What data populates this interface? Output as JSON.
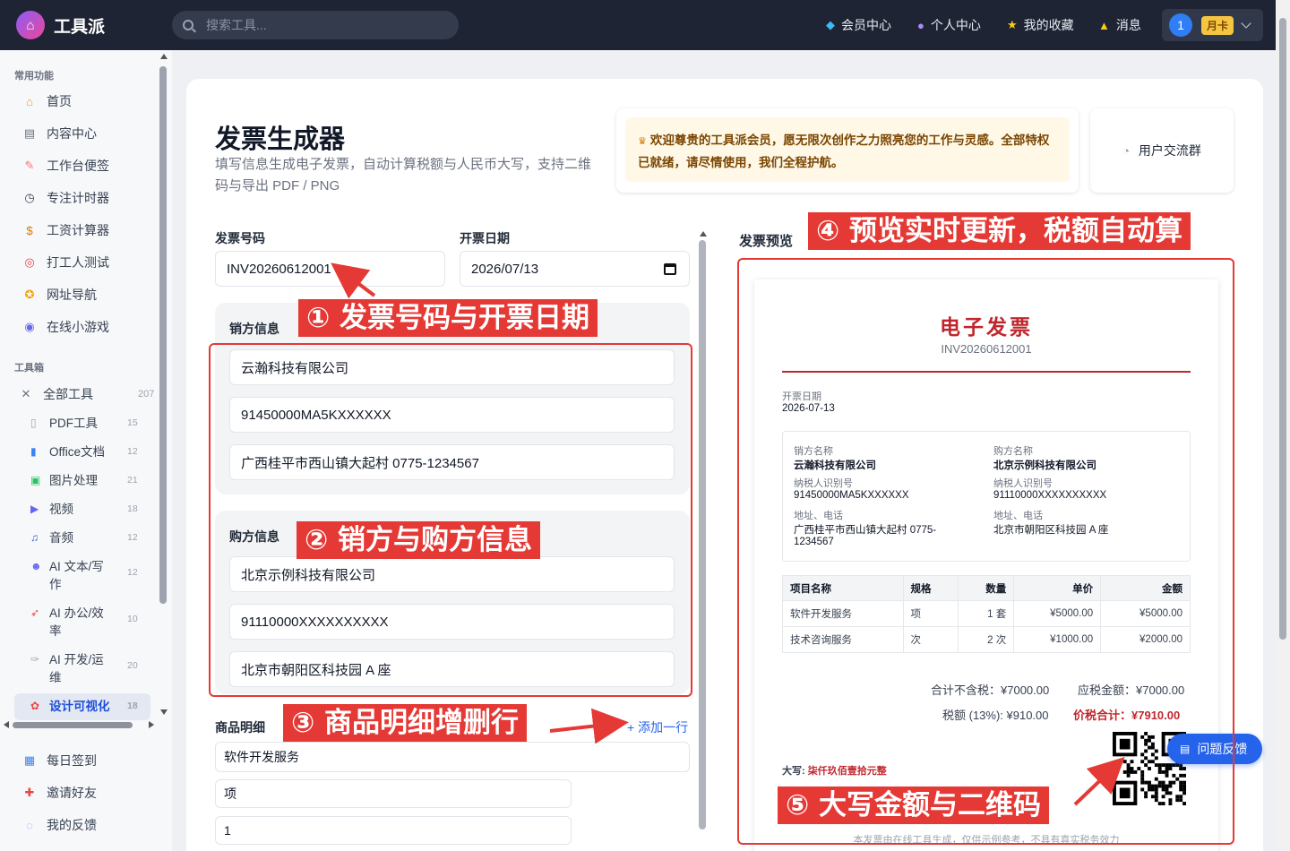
{
  "header": {
    "brand": "工具派",
    "search_placeholder": "搜索工具...",
    "nav": [
      "会员中心",
      "个人中心",
      "我的收藏",
      "消息"
    ],
    "user_avatar": "1",
    "vip_badge": "月卡"
  },
  "sidebar": {
    "section_common": "常用功能",
    "common": [
      {
        "label": "首页",
        "icon": "home-icon"
      },
      {
        "label": "内容中心",
        "icon": "content-icon"
      },
      {
        "label": "工作台便签",
        "icon": "note-icon"
      },
      {
        "label": "专注计时器",
        "icon": "timer-icon"
      },
      {
        "label": "工资计算器",
        "icon": "money-bag-icon"
      },
      {
        "label": "打工人测试",
        "icon": "target-icon"
      },
      {
        "label": "网址导航",
        "icon": "compass-icon"
      },
      {
        "label": "在线小游戏",
        "icon": "gamepad-icon"
      }
    ],
    "section_tools": "工具箱",
    "all_tools": {
      "label": "全部工具",
      "count": "207"
    },
    "tools": [
      {
        "label": "PDF工具",
        "count": "15"
      },
      {
        "label": "Office文档",
        "count": "12"
      },
      {
        "label": "图片处理",
        "count": "21"
      },
      {
        "label": "视频",
        "count": "18"
      },
      {
        "label": "音频",
        "count": "12"
      },
      {
        "label": "AI 文本/写作",
        "count": "12"
      },
      {
        "label": "AI 办公/效率",
        "count": "10"
      },
      {
        "label": "AI 开发/运维",
        "count": "20"
      },
      {
        "label": "设计可视化",
        "count": "18"
      }
    ],
    "bottom": [
      {
        "label": "每日签到"
      },
      {
        "label": "邀请好友"
      },
      {
        "label": "我的反馈"
      }
    ]
  },
  "page": {
    "title": "发票生成器",
    "subtitle": "填写信息生成电子发票，自动计算税额与人民币大写，支持二维码与导出 PDF / PNG",
    "notice": "欢迎尊贵的工具派会员，愿无限次创作之力照亮您的工作与灵感。全部特权已就绪，请尽情使用，我们全程护航。",
    "group_button": "用户交流群"
  },
  "form": {
    "invoice_no_label": "发票号码",
    "invoice_no": "INV20260612001",
    "date_label": "开票日期",
    "date": "2026/07/13",
    "seller_label": "销方信息",
    "seller_name": "云瀚科技有限公司",
    "seller_tax": "91450000MA5KXXXXXX",
    "seller_addr": "广西桂平市西山镇大起村 0775-1234567",
    "buyer_label": "购方信息",
    "buyer_name": "北京示例科技有限公司",
    "buyer_tax": "91110000XXXXXXXXXX",
    "buyer_addr": "北京市朝阳区科技园 A 座",
    "items_label": "商品明细",
    "add_row": "+ 添加一行",
    "item_name": "软件开发服务",
    "item_unit": "项",
    "item_qty": "1"
  },
  "preview": {
    "label": "发票预览",
    "title": "电子发票",
    "number": "INV20260612001",
    "date_label": "开票日期",
    "date": "2026-07-13",
    "seller_name_label": "销方名称",
    "seller_name": "云瀚科技有限公司",
    "seller_tax_label": "纳税人识别号",
    "seller_tax": "91450000MA5KXXXXXX",
    "seller_addr_label": "地址、电话",
    "seller_addr_1": "广西桂平市西山镇大起村 0775-",
    "seller_addr_2": "1234567",
    "buyer_name_label": "购方名称",
    "buyer_name": "北京示例科技有限公司",
    "buyer_tax_label": "纳税人识别号",
    "buyer_tax": "91110000XXXXXXXXXX",
    "buyer_addr_label": "地址、电话",
    "buyer_addr": "北京市朝阳区科技园 A 座",
    "columns": [
      "项目名称",
      "规格",
      "数量",
      "单价",
      "金额"
    ],
    "rows": [
      [
        "软件开发服务",
        "项",
        "1 套",
        "¥5000.00",
        "¥5000.00"
      ],
      [
        "技术咨询服务",
        "次",
        "2 次",
        "¥1000.00",
        "¥2000.00"
      ]
    ],
    "subtotal": "合计不含税：¥7000.00",
    "payable": "应税金额：¥7000.00",
    "tax": "税额 (13%): ¥910.00",
    "total": "价税合计：¥7910.00",
    "daxie_label": "大写:",
    "daxie": "柒仟玖佰壹拾元整",
    "footnote": "本发票由在线工具生成，仅供示例参考，不具有真实税务效力"
  },
  "feedback_button": "问题反馈",
  "annotations": [
    "① 发票号码与开票日期",
    "② 销方与购方信息",
    "③ 商品明细增删行",
    "④ 预览实时更新，税额自动算",
    "⑤ 大写金额与二维码"
  ],
  "colors": {
    "accent": "#2563eb",
    "annotation": "#e53935",
    "invoice_red": "#c0262d",
    "topbar": "#1e2434"
  }
}
